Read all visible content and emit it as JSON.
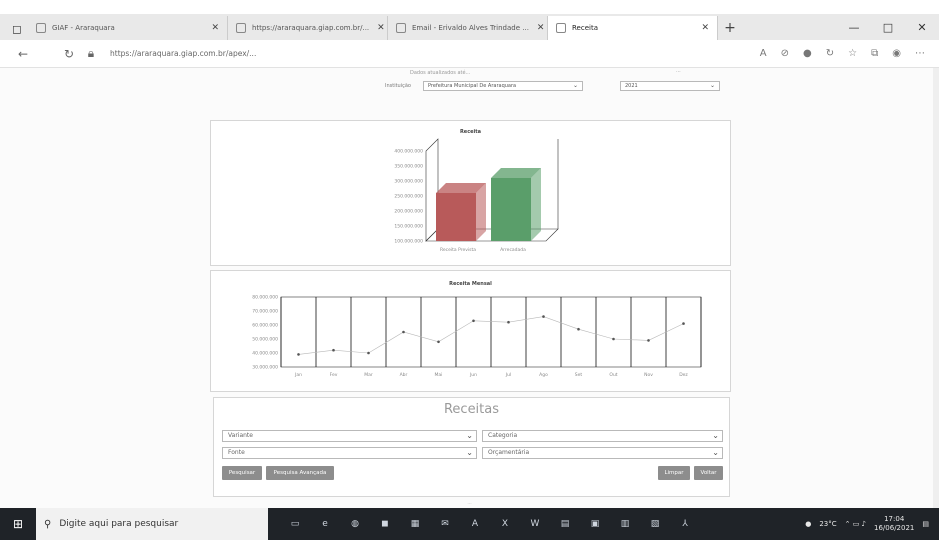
{
  "browser": {
    "tabs": [
      {
        "title": "GIAF - Araraquara",
        "active": false
      },
      {
        "title": "https://araraquara.giap.com.br/...",
        "active": false
      },
      {
        "title": "Email - Erivaldo Alves Trindade ...",
        "active": false
      },
      {
        "title": "Receita",
        "active": true
      }
    ],
    "url": "https://araraquara.giap.com.br/apex/...",
    "window_min": "—",
    "window_max": "□",
    "window_close": "✕",
    "new_tab": "+"
  },
  "page": {
    "top_caption": "Dados atualizados até...",
    "instituicao_label": "Instituição",
    "instituicao_value": "Prefeitura Municipal De Araraquara",
    "ano_value": "2021",
    "stamp": "..."
  },
  "chart_receita": {
    "title": "Receita",
    "y_ticks": [
      "400.000.000",
      "350.000.000",
      "300.000.000",
      "250.000.000",
      "200.000.000",
      "150.000.000",
      "100.000.000"
    ],
    "categories": [
      "Receita Prevista",
      "Arrecadada"
    ],
    "values": [
      260000000,
      310000000
    ],
    "colors": [
      "#b85a5a",
      "#5a9e6a"
    ]
  },
  "chart_mensal": {
    "title": "Receita Mensal",
    "y_ticks": [
      "80.000.000",
      "70.000.000",
      "60.000.000",
      "50.000.000",
      "40.000.000",
      "30.000.000"
    ],
    "months": [
      "Jan",
      "Fev",
      "Mar",
      "Abr",
      "Mai",
      "Jun",
      "Jul",
      "Ago",
      "Set",
      "Out",
      "Nov",
      "Dez"
    ],
    "values": [
      39000000,
      42000000,
      40000000,
      55000000,
      48000000,
      63000000,
      62000000,
      66000000,
      57000000,
      50000000,
      49000000,
      61000000
    ]
  },
  "filters": {
    "title": "Receitas",
    "select_1": "Variante",
    "select_2": "Categoria",
    "select_3": "Fonte",
    "select_4": "Orçamentária",
    "btn_pesquisar": "Pesquisar",
    "btn_pesquisa_avancada": "Pesquisa Avançada",
    "btn_limpar": "Limpar",
    "btn_voltar": "Voltar"
  },
  "footer_note": "...",
  "taskbar": {
    "search_placeholder": "Digite aqui para pesquisar",
    "temperature": "23°C",
    "time": "17:04",
    "date": "16/06/2021"
  }
}
